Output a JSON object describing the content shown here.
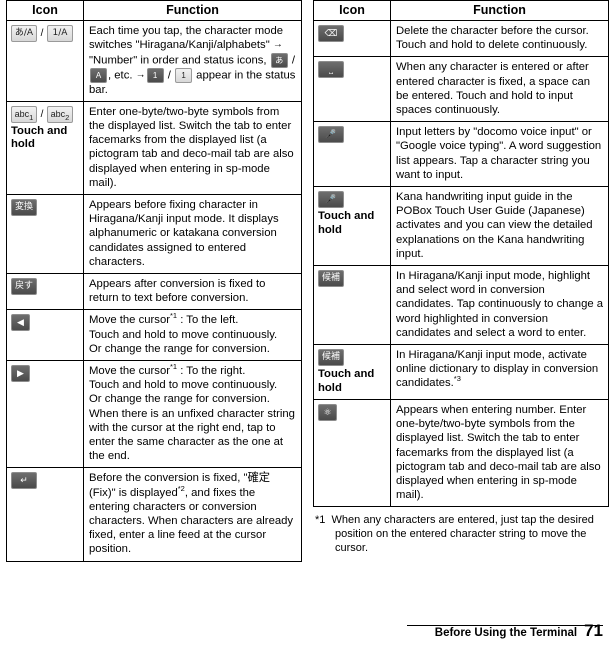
{
  "document": {
    "footer_chapter": "Before Using the Terminal",
    "page_number": "71"
  },
  "table_headers": {
    "icon": "Icon",
    "function": "Function"
  },
  "left_column": {
    "rows": [
      {
        "icon_keys": [
          "あ/A",
          "1/A"
        ],
        "icon_label": "",
        "text": "Each time you tap, the character mode switches \"Hiragana/Kanji/alphabets\" → \"Number\" in order and status icons, あ / A , etc. → 1 / 1 appear in the status bar."
      },
      {
        "icon_keys": [
          "abc 1",
          "abc 2"
        ],
        "icon_label": "Touch and hold",
        "text": "Enter one-byte/two-byte symbols from the displayed list. Switch the tab to enter facemarks from the displayed list (a pictogram tab and deco-mail tab are also displayed when entering in sp-mode mail)."
      },
      {
        "icon_keys": [
          "変換"
        ],
        "icon_label": "",
        "text": "Appears before fixing character in Hiragana/Kanji input mode. It displays alphanumeric or katakana conversion candidates assigned to entered characters."
      },
      {
        "icon_keys": [
          "戻す"
        ],
        "icon_label": "",
        "text": "Appears after conversion is fixed to return to text before conversion."
      },
      {
        "icon_keys": [
          "◀"
        ],
        "icon_label": "",
        "text": "Move the cursor*1 : To the left.\nTouch and hold to move continuously.\nOr change the range for conversion."
      },
      {
        "icon_keys": [
          "▶"
        ],
        "icon_label": "",
        "text": "Move the cursor*1 : To the right.\nTouch and hold to move continuously.\nOr change the range for conversion.\nWhen there is an unfixed character string with the cursor at the right end, tap to enter the same character as the one at the end."
      },
      {
        "icon_keys": [
          "↵"
        ],
        "icon_label": "",
        "text": "Before the conversion is fixed, \"確定 (Fix)\" is displayed*2, and fixes the entering characters or conversion characters. When characters are already fixed, enter a line feed at the cursor position."
      }
    ]
  },
  "right_column": {
    "rows": [
      {
        "icon_keys": [
          "⌫"
        ],
        "icon_label": "",
        "text": "Delete the character before the cursor. Touch and hold to delete continuously."
      },
      {
        "icon_keys": [
          "␣"
        ],
        "icon_label": "",
        "text": "When any character is entered or after entered character is fixed, a space can be entered. Touch and hold to input spaces continuously."
      },
      {
        "icon_keys": [
          "🎤"
        ],
        "icon_label": "",
        "text": "Input letters by \"docomo voice input\" or \"Google voice typing\". A word suggestion list appears. Tap a character string you want to input."
      },
      {
        "icon_keys": [
          "🎤"
        ],
        "icon_label": "Touch and hold",
        "text": "Kana handwriting input guide in the POBox Touch User Guide (Japanese) activates and you can view the detailed explanations on the Kana handwriting input."
      },
      {
        "icon_keys": [
          "候補"
        ],
        "icon_label": "",
        "text": "In Hiragana/Kanji input mode, highlight and select word in conversion candidates. Tap continuously to change a word highlighted in conversion candidates and select a word to enter."
      },
      {
        "icon_keys": [
          "候補"
        ],
        "icon_label": "Touch and hold",
        "text": "In Hiragana/Kanji input mode, activate online dictionary to display in conversion candidates.*3"
      },
      {
        "icon_keys": [
          "⊕"
        ],
        "icon_label": "",
        "text": "Appears when entering number. Enter one-byte/two-byte symbols from the displayed list. Switch the tab to enter facemarks from the displayed list (a pictogram tab and deco-mail tab are also displayed when entering in sp-mode mail)."
      }
    ]
  },
  "footnotes": [
    {
      "marker": "*1",
      "text": "When any characters are entered, just tap the desired position on the entered character string to move the cursor."
    }
  ]
}
